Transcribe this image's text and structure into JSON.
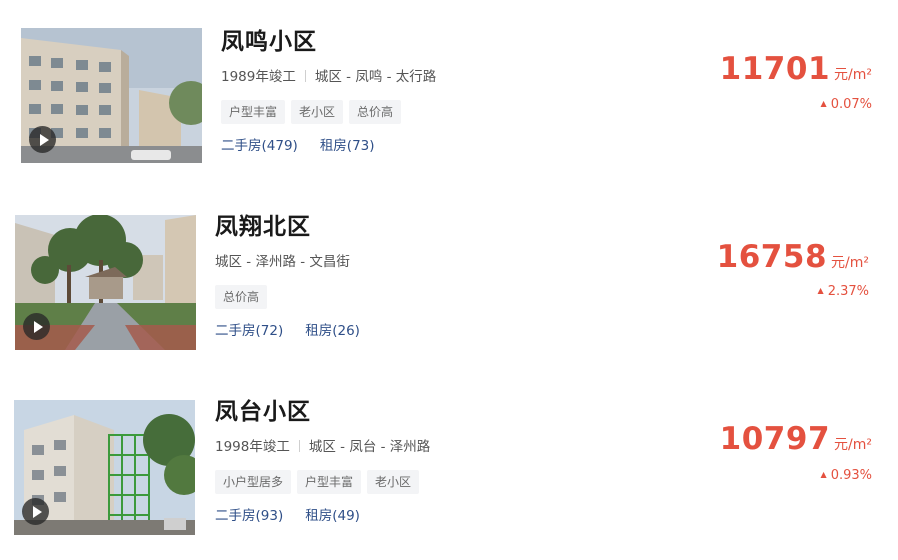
{
  "listings": [
    {
      "name": "凤鸣小区",
      "built": "1989年竣工",
      "location": "城区 - 凤鸣 - 太行路",
      "tags": [
        "户型丰富",
        "老小区",
        "总价高"
      ],
      "second_hand": "二手房(479)",
      "rent": "租房(73)",
      "price": "11701",
      "unit": "元/m²",
      "change": "0.07%",
      "change_direction": "up"
    },
    {
      "name": "凤翔北区",
      "built": "",
      "location": "城区 - 泽州路 - 文昌街",
      "tags": [
        "总价高"
      ],
      "second_hand": "二手房(72)",
      "rent": "租房(26)",
      "price": "16758",
      "unit": "元/m²",
      "change": "2.37%",
      "change_direction": "up"
    },
    {
      "name": "凤台小区",
      "built": "1998年竣工",
      "location": "城区 - 凤台 - 泽州路",
      "tags": [
        "小户型居多",
        "户型丰富",
        "老小区"
      ],
      "second_hand": "二手房(93)",
      "rent": "租房(49)",
      "price": "10797",
      "unit": "元/m²",
      "change": "0.93%",
      "change_direction": "up"
    }
  ],
  "icons": {
    "play": "play-icon",
    "change_up": "triangle-up-icon"
  },
  "colors": {
    "price": "#e4513f",
    "link": "#2f4f88",
    "tag_bg": "#f3f4f6"
  }
}
